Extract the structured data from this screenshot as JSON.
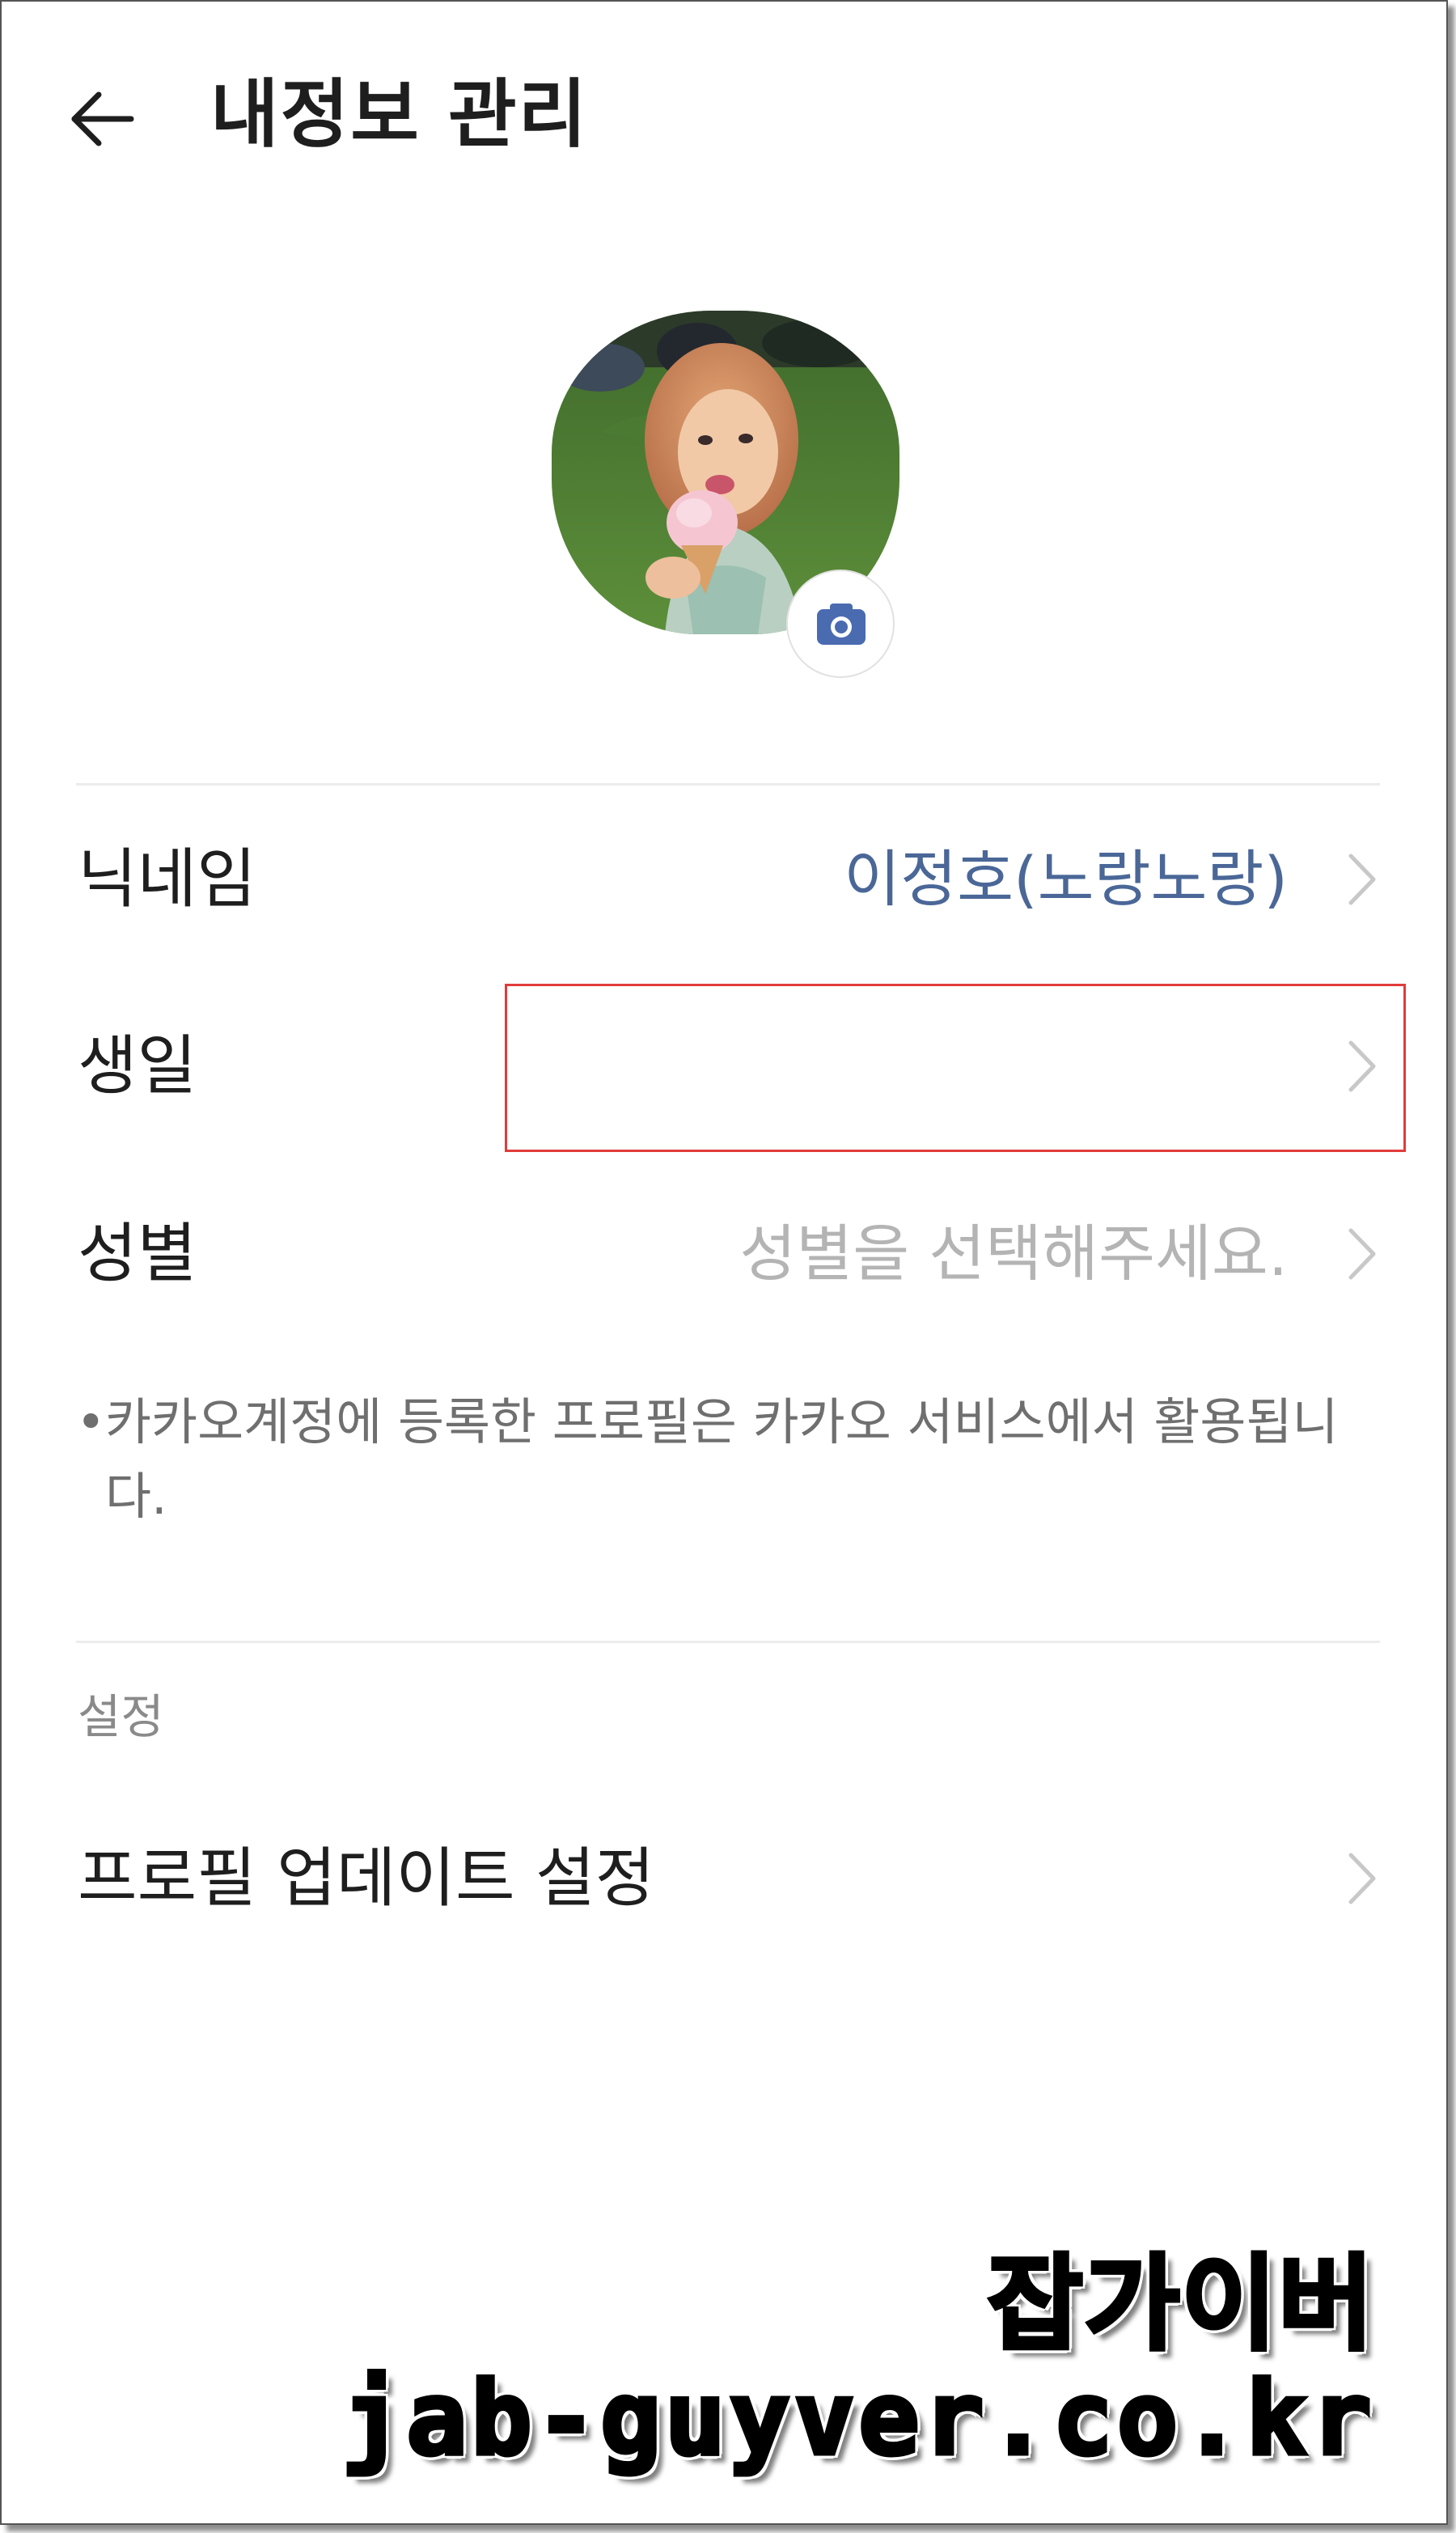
{
  "header": {
    "title": "내정보 관리",
    "back_icon": "arrow-left-icon"
  },
  "profile": {
    "camera_icon": "camera-icon",
    "camera_color": "#4a6bb0"
  },
  "rows": [
    {
      "label": "닉네임",
      "value": "이정호(노랑노랑)",
      "value_color": "#4a6797"
    },
    {
      "label": "생일",
      "value": ""
    },
    {
      "label": "성별",
      "value": "성별을 선택해주세요.",
      "value_color": "#b4b4b4"
    }
  ],
  "notice": {
    "bullet": "•",
    "text": "카카오계정에 등록한 프로필은 카카오 서비스에서 활용됩니다."
  },
  "settings": {
    "section_label": "설정",
    "profile_update_label": "프로필 업데이트 설정"
  },
  "watermark": {
    "name": "잡가이버",
    "url": "jab-guyver.co.kr"
  },
  "colors": {
    "highlight_box": "#e23b3b",
    "chevron": "#c8c8c8",
    "divider": "#ececec"
  }
}
